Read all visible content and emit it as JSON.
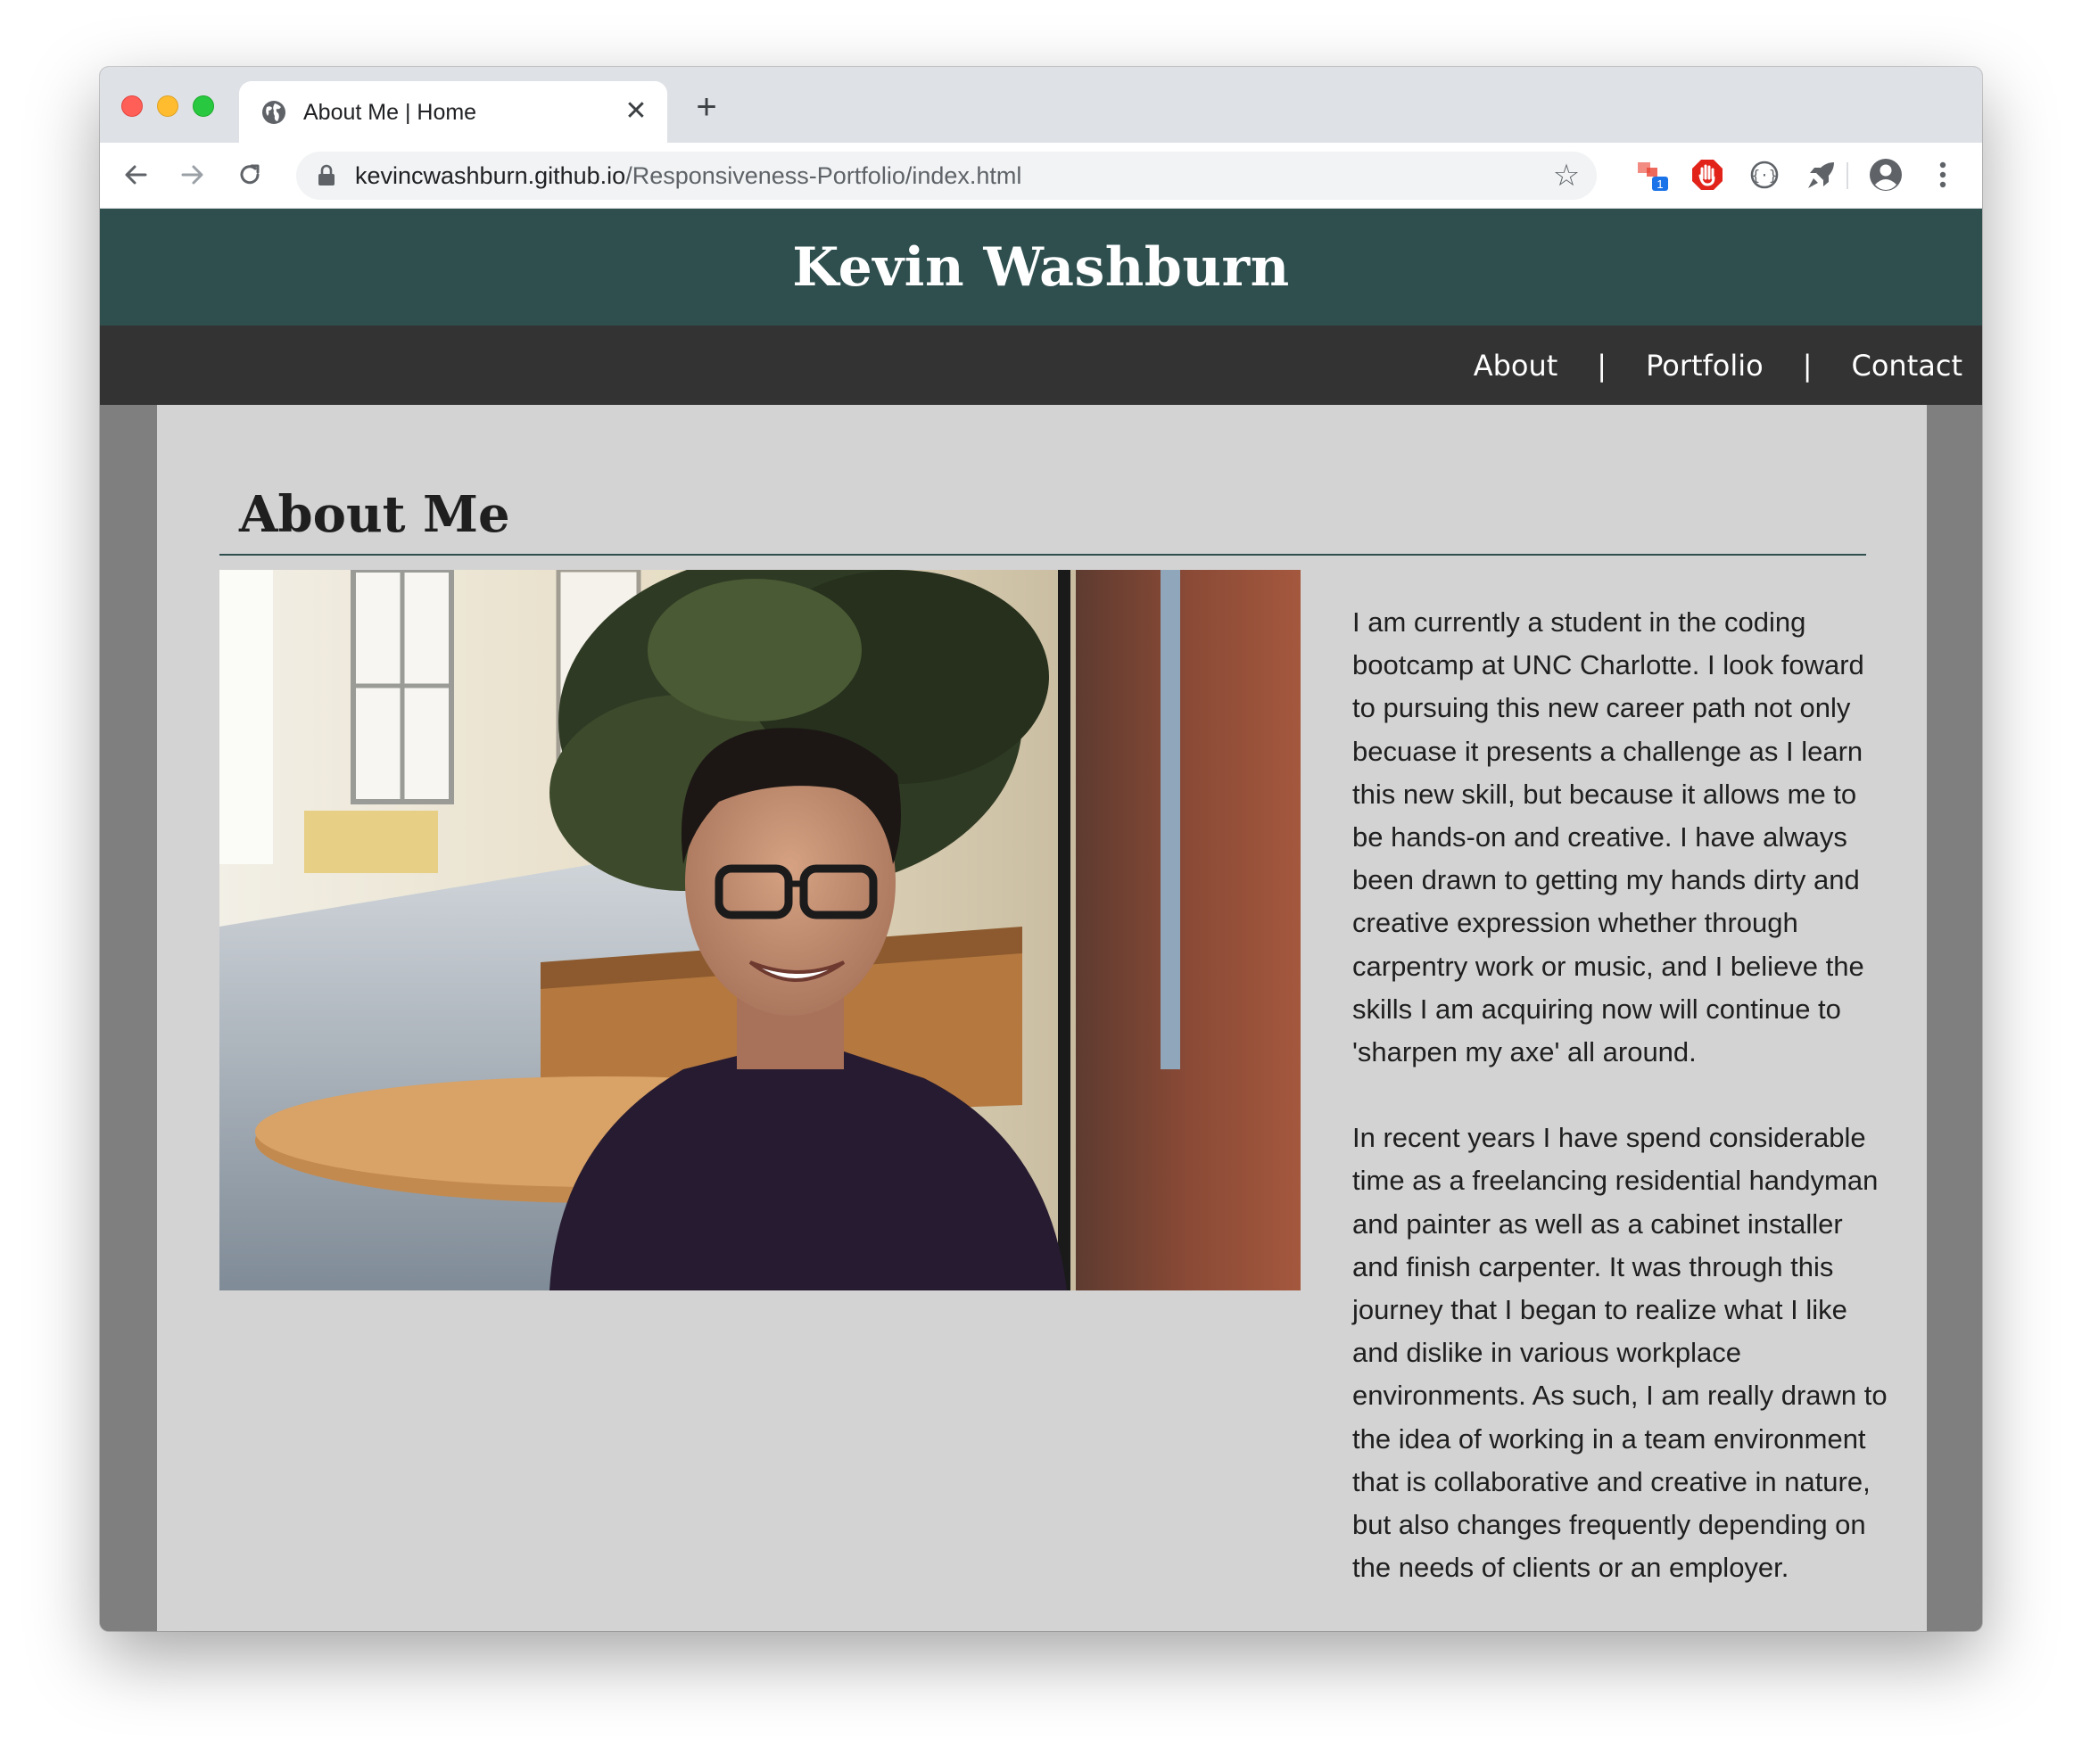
{
  "browser": {
    "tab": {
      "title": "About Me | Home",
      "close_glyph": "✕",
      "favicon_icon": "globe-icon"
    },
    "new_tab_glyph": "+",
    "url_host": "kevincwashburn.github.io",
    "url_path": "/Responsiveness-Portfolio/index.html",
    "bookmark_glyph": "☆",
    "extension_badge": "1",
    "icons": [
      "back-arrow-icon",
      "forward-arrow-icon",
      "reload-icon",
      "lock-icon",
      "star-icon",
      "extension-icon",
      "adblock-icon",
      "extension-icon",
      "rocket-icon",
      "profile-icon",
      "kebab-menu-icon"
    ]
  },
  "site": {
    "title": "Kevin Washburn",
    "nav": {
      "items": [
        "About",
        "Portfolio",
        "Contact"
      ],
      "separator": "|"
    },
    "section_title": "About Me",
    "bio": [
      "I am currently a student in the coding bootcamp at UNC Charlotte. I look foward to pursuing this new career path not only becuase it presents a challenge as I learn this new skill, but because it allows me to be hands-on and creative. I have always been drawn to getting my hands dirty and creative expression whether through carpentry work or music, and I believe the skills I am acquiring now will continue to 'sharpen my axe' all around.",
      "In recent years I have spend considerable time as a freelancing residential handyman and painter as well as a cabinet installer and finish carpenter. It was through this journey that I began to realize what I like and dislike in various workplace environments. As such, I am really drawn to the idea of working in a team environment that is collaborative and creative in nature, but also changes frequently depending on the needs of clients or an employer."
    ]
  },
  "colors": {
    "header_bg": "#2f4f4f",
    "nav_bg": "#333333",
    "content_bg": "#d3d3d3",
    "page_bg": "#7f7f7f",
    "tabstrip_bg": "#dee1e6"
  }
}
